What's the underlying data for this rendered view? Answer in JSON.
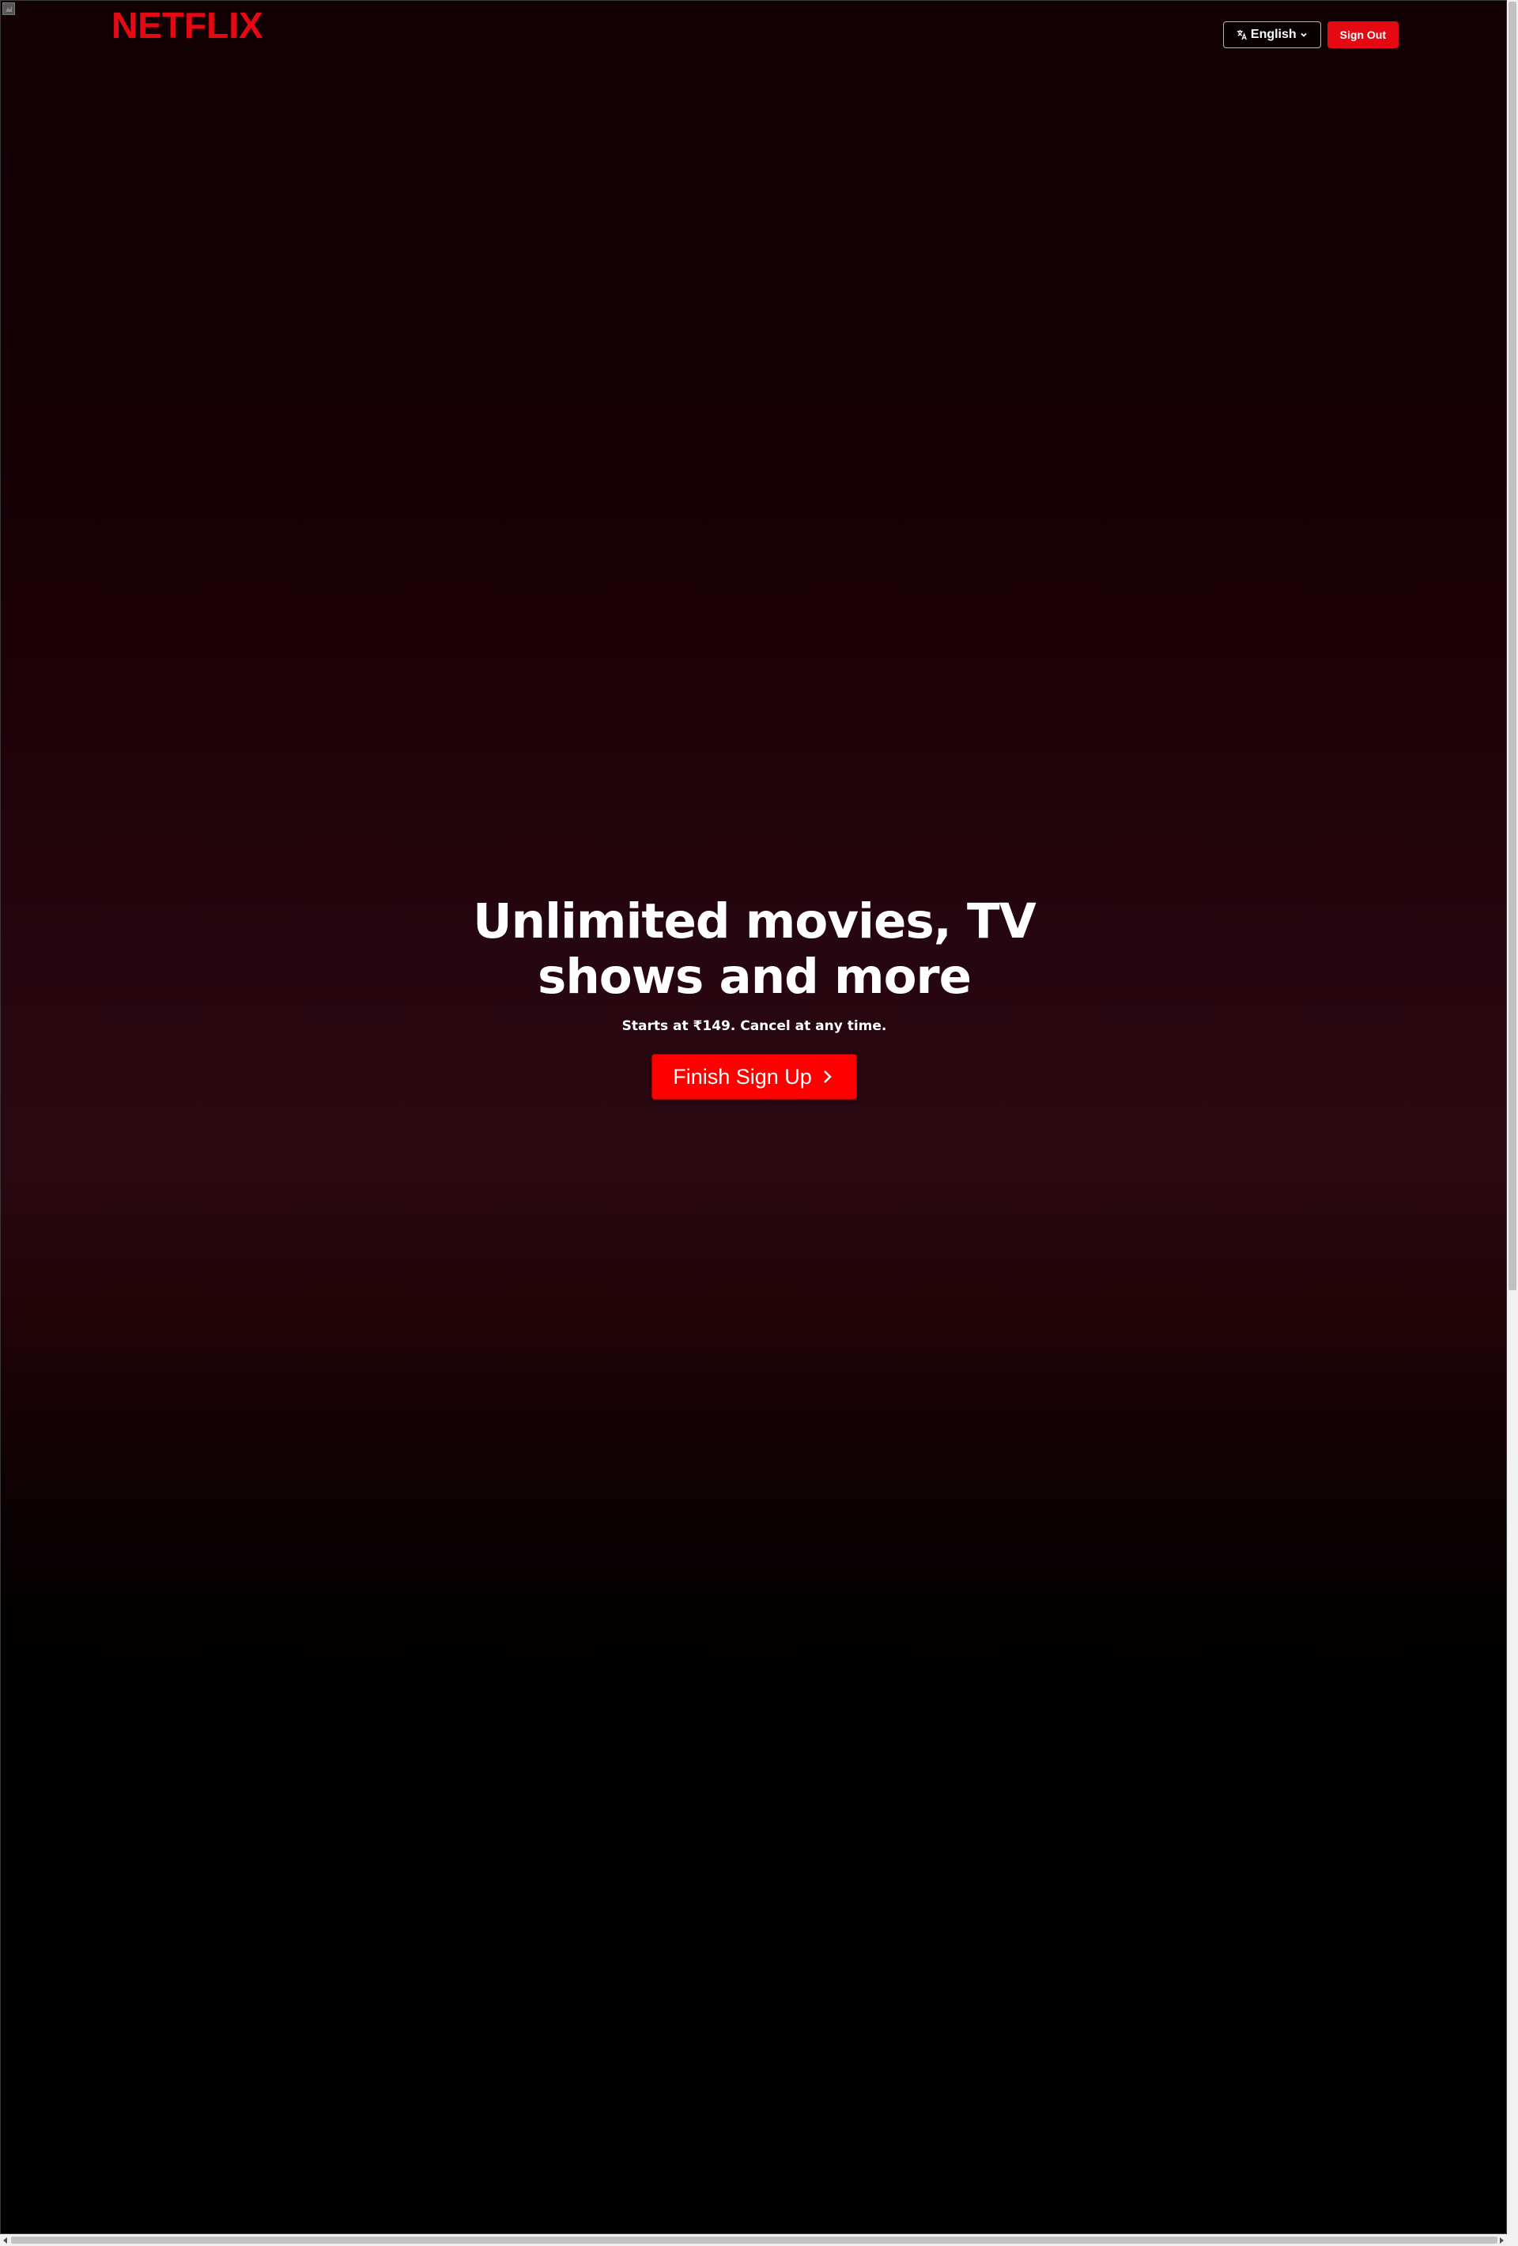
{
  "header": {
    "logo_text": "NETFLIX",
    "language_selector": {
      "selected": "English",
      "icon": "translate-icon",
      "chevron_icon": "chevron-down-icon"
    },
    "sign_out_label": "Sign Out"
  },
  "hero": {
    "title_line1": "Unlimited movies, TV",
    "title_line2": "shows and more",
    "subtitle": "Starts at ₹149. Cancel at any time.",
    "cta_label": "Finish Sign Up",
    "cta_icon": "chevron-right-icon"
  },
  "colors": {
    "brand": "#e50914",
    "cta": "#ff0000",
    "background_top": "#120003",
    "background_glow": "#2a0812",
    "background_bottom": "#000000",
    "text": "#ffffff"
  },
  "broken_image_icon": "broken-image-icon"
}
